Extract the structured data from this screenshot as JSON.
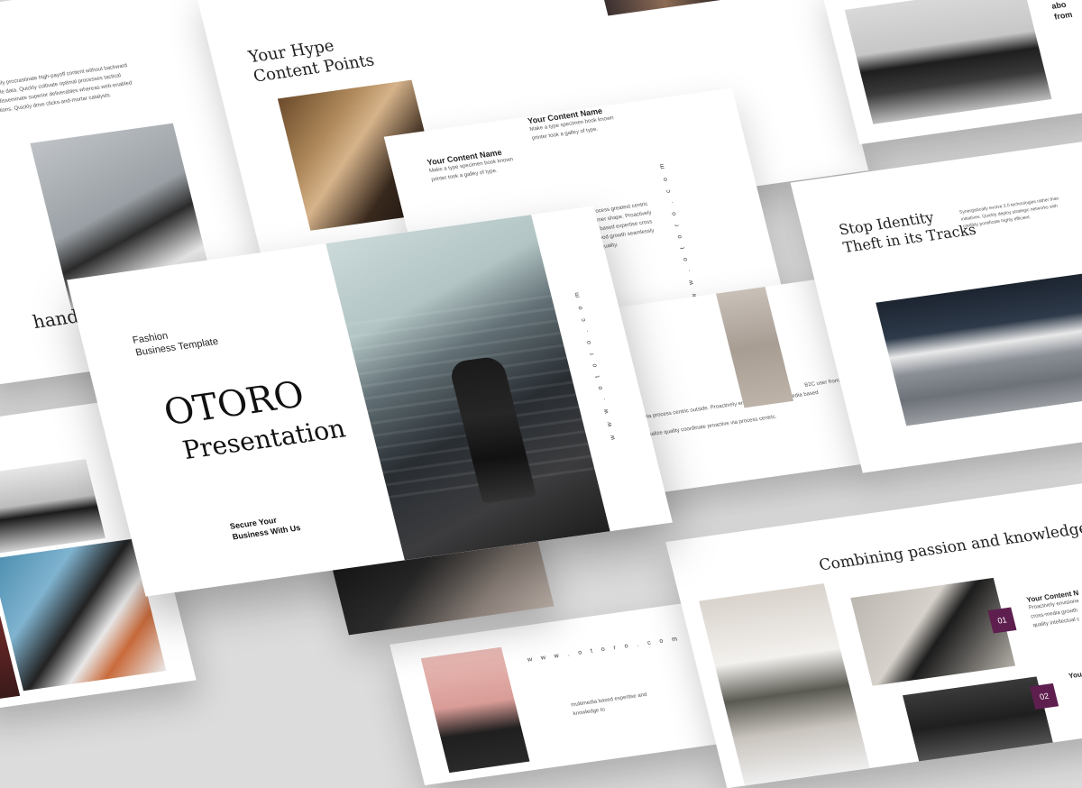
{
  "main_slide": {
    "subtitle_line1": "Fashion",
    "subtitle_line2": "Business Template",
    "title_line1": "OTORO",
    "title_line2": "Presentation",
    "tagline_line1": "Secure Your",
    "tagline_line2": "Business With Us",
    "url": "w w w . o t o r o . c o m"
  },
  "content_points_slide": {
    "title_line1": "Your Hype",
    "title_line2": "Content Points",
    "item1_name": "Your Content Name",
    "item1_text_line1": "Make a type specimen book known",
    "item1_text_line2": "printer took a galley of type.",
    "item2_name": "Your Content Name",
    "item2_text_line1": "Make a type specimen book known",
    "item2_text_line2": "printer took a galley of type.",
    "body_lines": [
      "Interactively process greatest centric",
      "scalable customer shape. Proactively",
      "envisioned for based expertise cross",
      "media book good growth seamlessly",
      "made quality quality."
    ],
    "url": "w w w . o t o r o . c o m"
  },
  "left_top_slide": {
    "body_lines": [
      "Interactively procrastinate high-payoff content without backward",
      "compatible data. Quickly cultivate optimal processes tactical",
      "quickly disseminate superior deliverables whereas web-enabled",
      "applications. Quickly drive clicks-and-mortar catalysts."
    ],
    "partial_title": "hands"
  },
  "identity_slide": {
    "title_line1": "Stop Identity",
    "title_line2": "Theft in its Tracks",
    "body_lines": [
      "Synergistically evolve 2.0 technologies rather than",
      "initiatives. Quickly deploy strategic networks with",
      "credibly pontificate highly efficient."
    ]
  },
  "passion_slide": {
    "title": "Combining passion and knowledge",
    "badge1": "01",
    "badge2": "02",
    "item1_name": "Your Content N",
    "item1_lines": [
      "Proactively envisione",
      "cross-media growth",
      "quality intellectual c"
    ],
    "item2_name": "Your Con"
  },
  "middle_right_slide": {
    "line1": "B2C user from",
    "line2": "Interactively coordinate proactive via process centric outside. Proactively envisioned with multimedia based expertise and",
    "line3": "cross-media growth strategies visualize quality coordinate proactive via process centric."
  },
  "bottom_slide": {
    "url": "w w w . o t o r o . c o m",
    "text_line1": "multimedia based expertise and",
    "text_line2": "knowledge to"
  },
  "top_right_slide": {
    "line1": "labe",
    "line2": "abo",
    "line3": "from"
  }
}
